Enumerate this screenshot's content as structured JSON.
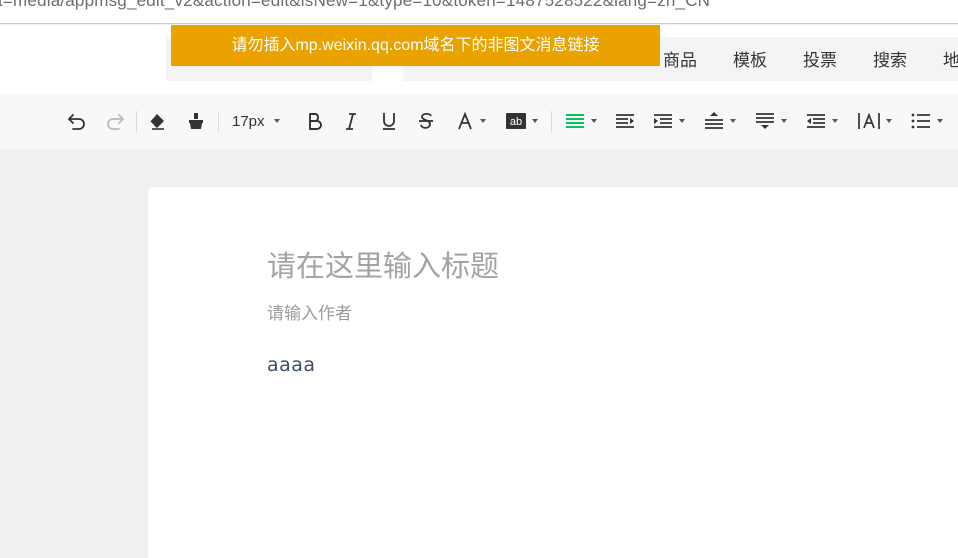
{
  "browser": {
    "url_fragment": "t=media/appmsg_edit_v2&action=edit&isNew=1&type=10&token=1487528522&lang=zh_CN"
  },
  "warning": {
    "text": "请勿插入mp.weixin.qq.com域名下的非图文消息链接"
  },
  "menu": {
    "items": [
      "商品",
      "模板",
      "投票",
      "搜索",
      "地"
    ]
  },
  "toolbar": {
    "font_size": "17px",
    "accent_color": "#07c160",
    "icons": [
      "undo-icon",
      "redo-icon",
      "eraser-icon",
      "format-brush-icon",
      "bold-icon",
      "italic-icon",
      "underline-icon",
      "strikethrough-icon",
      "font-color-icon",
      "background-color-icon",
      "align-left-icon",
      "indent-icon",
      "align-icon",
      "line-height-icon",
      "paragraph-spacing-icon",
      "outdent-icon",
      "letter-spacing-icon",
      "list-icon"
    ]
  },
  "editor": {
    "title_placeholder": "请在这里输入标题",
    "author_placeholder": "请输入作者",
    "content": "aaaa"
  },
  "colors": {
    "warning_bg": "#e9a200",
    "background": "#f0f0f0"
  }
}
